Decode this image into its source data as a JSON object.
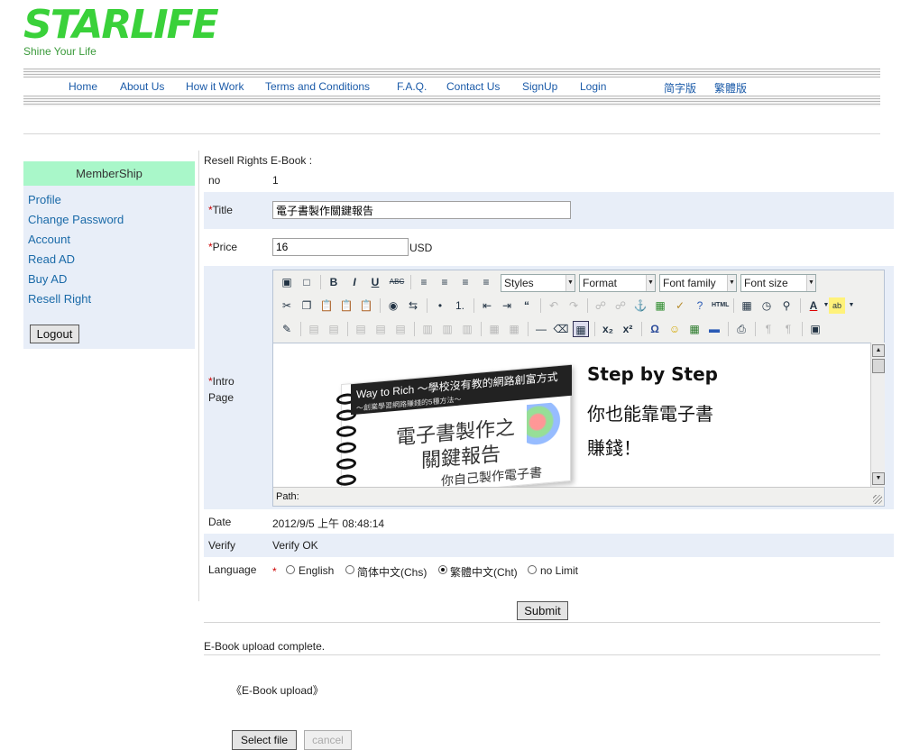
{
  "header": {
    "logo": "STARLIFE",
    "tagline": "Shine Your Life"
  },
  "nav": {
    "items": [
      "Home",
      "About Us",
      "How it Work",
      "Terms and Conditions",
      "F.A.Q.",
      "Contact Us",
      "SignUp",
      "Login"
    ],
    "lang_links": [
      "简字版",
      "繁體版"
    ]
  },
  "sidebar": {
    "title": "MemberShip",
    "items": [
      "Profile",
      "Change Password",
      "Account",
      "Read AD",
      "Buy AD",
      "Resell Right"
    ],
    "logout": "Logout"
  },
  "form": {
    "heading": "Resell Rights E-Book :",
    "required_mark": "*",
    "no_label": "no",
    "no_value": "1",
    "title_label": "Title",
    "title_value": "電子書製作關鍵報告",
    "price_label": "Price",
    "price_value": "16",
    "price_unit": "USD",
    "intro_label": "Intro Page",
    "date_label": "Date",
    "date_value": "2012/9/5 上午 08:48:14",
    "verify_label": "Verify",
    "verify_value": "Verify OK",
    "language_label": "Language",
    "languages": [
      {
        "label": "English",
        "selected": false
      },
      {
        "label": "简体中文(Chs)",
        "selected": false
      },
      {
        "label": "繁體中文(Cht)",
        "selected": true
      },
      {
        "label": "no Limit",
        "selected": false
      }
    ],
    "submit": "Submit"
  },
  "editor": {
    "styles": "Styles",
    "format": "Format",
    "font_family": "Font family",
    "font_size": "Font size",
    "path_label": "Path:",
    "content": {
      "book_band_title": "Way to Rich ～學校沒有教的網路創富方式",
      "book_band_sub": "～創業學習網路賺錢的5種方法～",
      "book_title_line1": "電子書製作之",
      "book_title_line2": "關鍵報告",
      "book_title_line3": "你自己製作電子書",
      "headline": "Step by Step",
      "line2": "你也能靠電子書",
      "line3": "賺錢！"
    }
  },
  "upload": {
    "status": "E-Book upload complete.",
    "section_title": "《E-Book upload》",
    "select_button": "Select file",
    "cancel_button": "cancel"
  },
  "colors": {
    "logo_green": "#3ad13a",
    "link_blue": "#1a5aa8",
    "sidebar_header": "#a9f7c9",
    "row_shade": "#e8eef8",
    "required_red": "#cc0000"
  }
}
